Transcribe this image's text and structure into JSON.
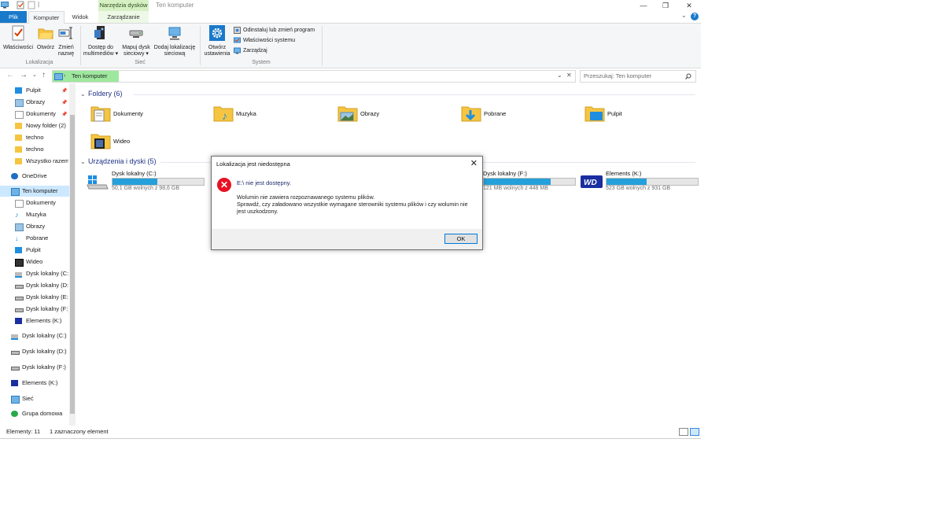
{
  "window": {
    "context_tab": "Narzędzia dysków",
    "title": "Ten komputer"
  },
  "tabs": {
    "file": "Plik",
    "items": [
      "Komputer",
      "Widok",
      "Zarządzanie"
    ]
  },
  "ribbon": {
    "lokalizacja": {
      "buttons": [
        "Właściwości",
        "Otwórz",
        "Zmień\nnazwę"
      ],
      "label": "Lokalizacja"
    },
    "siec": {
      "buttons": [
        "Dostęp do\nmultimediów ▾",
        "Mapuj dysk\nsieciowy ▾",
        "Dodaj lokalizację\nsieciową"
      ],
      "label": "Sieć"
    },
    "system": {
      "big_button": "Otwórz\nustawienia",
      "small": [
        "Odinstaluj lub zmień program",
        "Właściwości systemu",
        "Zarządzaj"
      ],
      "label": "System"
    }
  },
  "address": {
    "path": "Ten komputer",
    "search_placeholder": "Przeszukaj: Ten komputer"
  },
  "navpane": {
    "quick": [
      "Pulpit",
      "Obrazy",
      "Dokumenty",
      "Nowy folder (2)",
      "techno",
      "techno",
      "Wszystko razem"
    ],
    "onedrive": "OneDrive",
    "thispc": "Ten komputer",
    "thispc_children": [
      "Dokumenty",
      "Muzyka",
      "Obrazy",
      "Pobrane",
      "Pulpit",
      "Wideo",
      "Dysk lokalny (C:)",
      "Dysk lokalny (D:)",
      "Dysk lokalny (E:)",
      "Dysk lokalny (F:)",
      "Elements (K:)"
    ],
    "roots": [
      "Dysk lokalny (C:)",
      "Dysk lokalny (D:)",
      "Dysk lokalny (F:)",
      "Elements (K:)",
      "Sieć",
      "Grupa domowa"
    ]
  },
  "content": {
    "folders_header": "Foldery (6)",
    "folders": [
      "Dokumenty",
      "Muzyka",
      "Obrazy",
      "Pobrane",
      "Pulpit",
      "Wideo"
    ],
    "drives_header": "Urządzenia i dyski (5)",
    "drives": [
      {
        "name": "Dysk lokalny (C:)",
        "free": "50,1 GB wolnych z 98,6 GB",
        "used_fraction": 0.49
      },
      {
        "name": "Dysk lokalny (F:)",
        "free": "121 MB wolnych z 448 MB",
        "used_fraction": 0.73
      },
      {
        "name": "Elements (K:)",
        "free": "523 GB wolnych z 931 GB",
        "used_fraction": 0.44
      }
    ]
  },
  "status": {
    "count": "Elementy: 11",
    "selected": "1 zaznaczony element"
  },
  "dialog": {
    "title": "Lokalizacja jest niedostępna",
    "main": "E:\\ nie jest dostępny.",
    "line1": "Wolumin nie zawiera rozpoznawanego systemu plików.",
    "line2": "Sprawdź, czy załadowano wszystkie wymagane sterowniki systemu plików i czy wolumin nie jest uszkodzony.",
    "ok": "OK"
  },
  "icons": {
    "folder_color": "#f5c542",
    "accent": "#1979ca",
    "bar_fill": "#26a0da",
    "error": "#e81123"
  }
}
